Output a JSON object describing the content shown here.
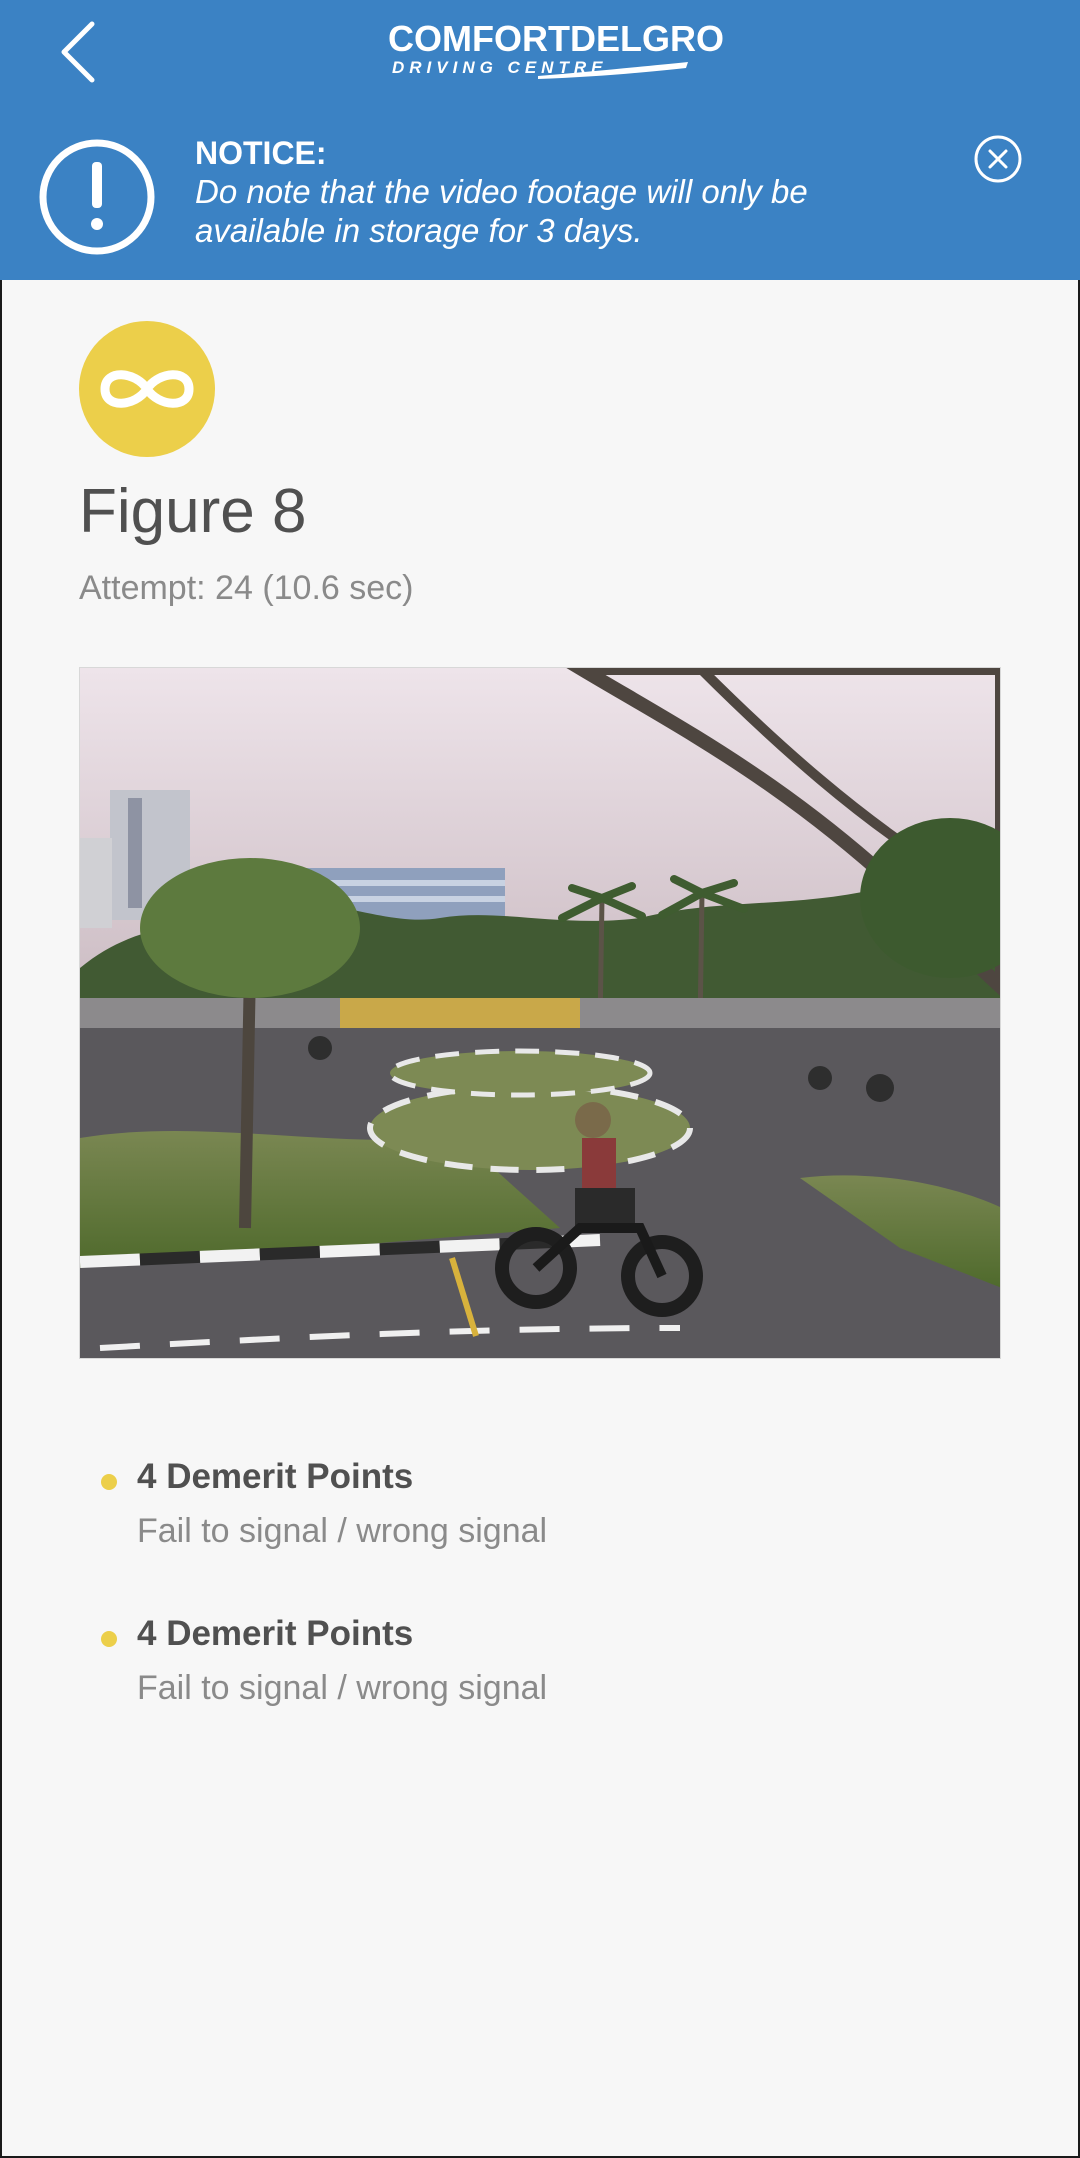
{
  "header": {
    "logo_main": "COMFORTDELGRO",
    "logo_sub": "DRIVING CENTRE",
    "background_color": "#3b82c4",
    "back_icon": "chevron-left-icon"
  },
  "notice": {
    "title": "NOTICE:",
    "text": "Do note that the video footage will only be available in storage for 3 days.",
    "icon": "exclamation-circle-icon",
    "close_icon": "close-circle-icon"
  },
  "test": {
    "badge_icon": "infinity-icon",
    "badge_color": "#eccf4a",
    "title": "Figure 8",
    "attempt": "Attempt: 24 (10.6 sec)"
  },
  "video": {
    "thumbnail": "motorcycle-figure-8-course"
  },
  "demerits": [
    {
      "points": "4 Demerit Points",
      "reason": "Fail to signal / wrong signal"
    },
    {
      "points": "4 Demerit Points",
      "reason": "Fail to signal / wrong signal"
    }
  ]
}
